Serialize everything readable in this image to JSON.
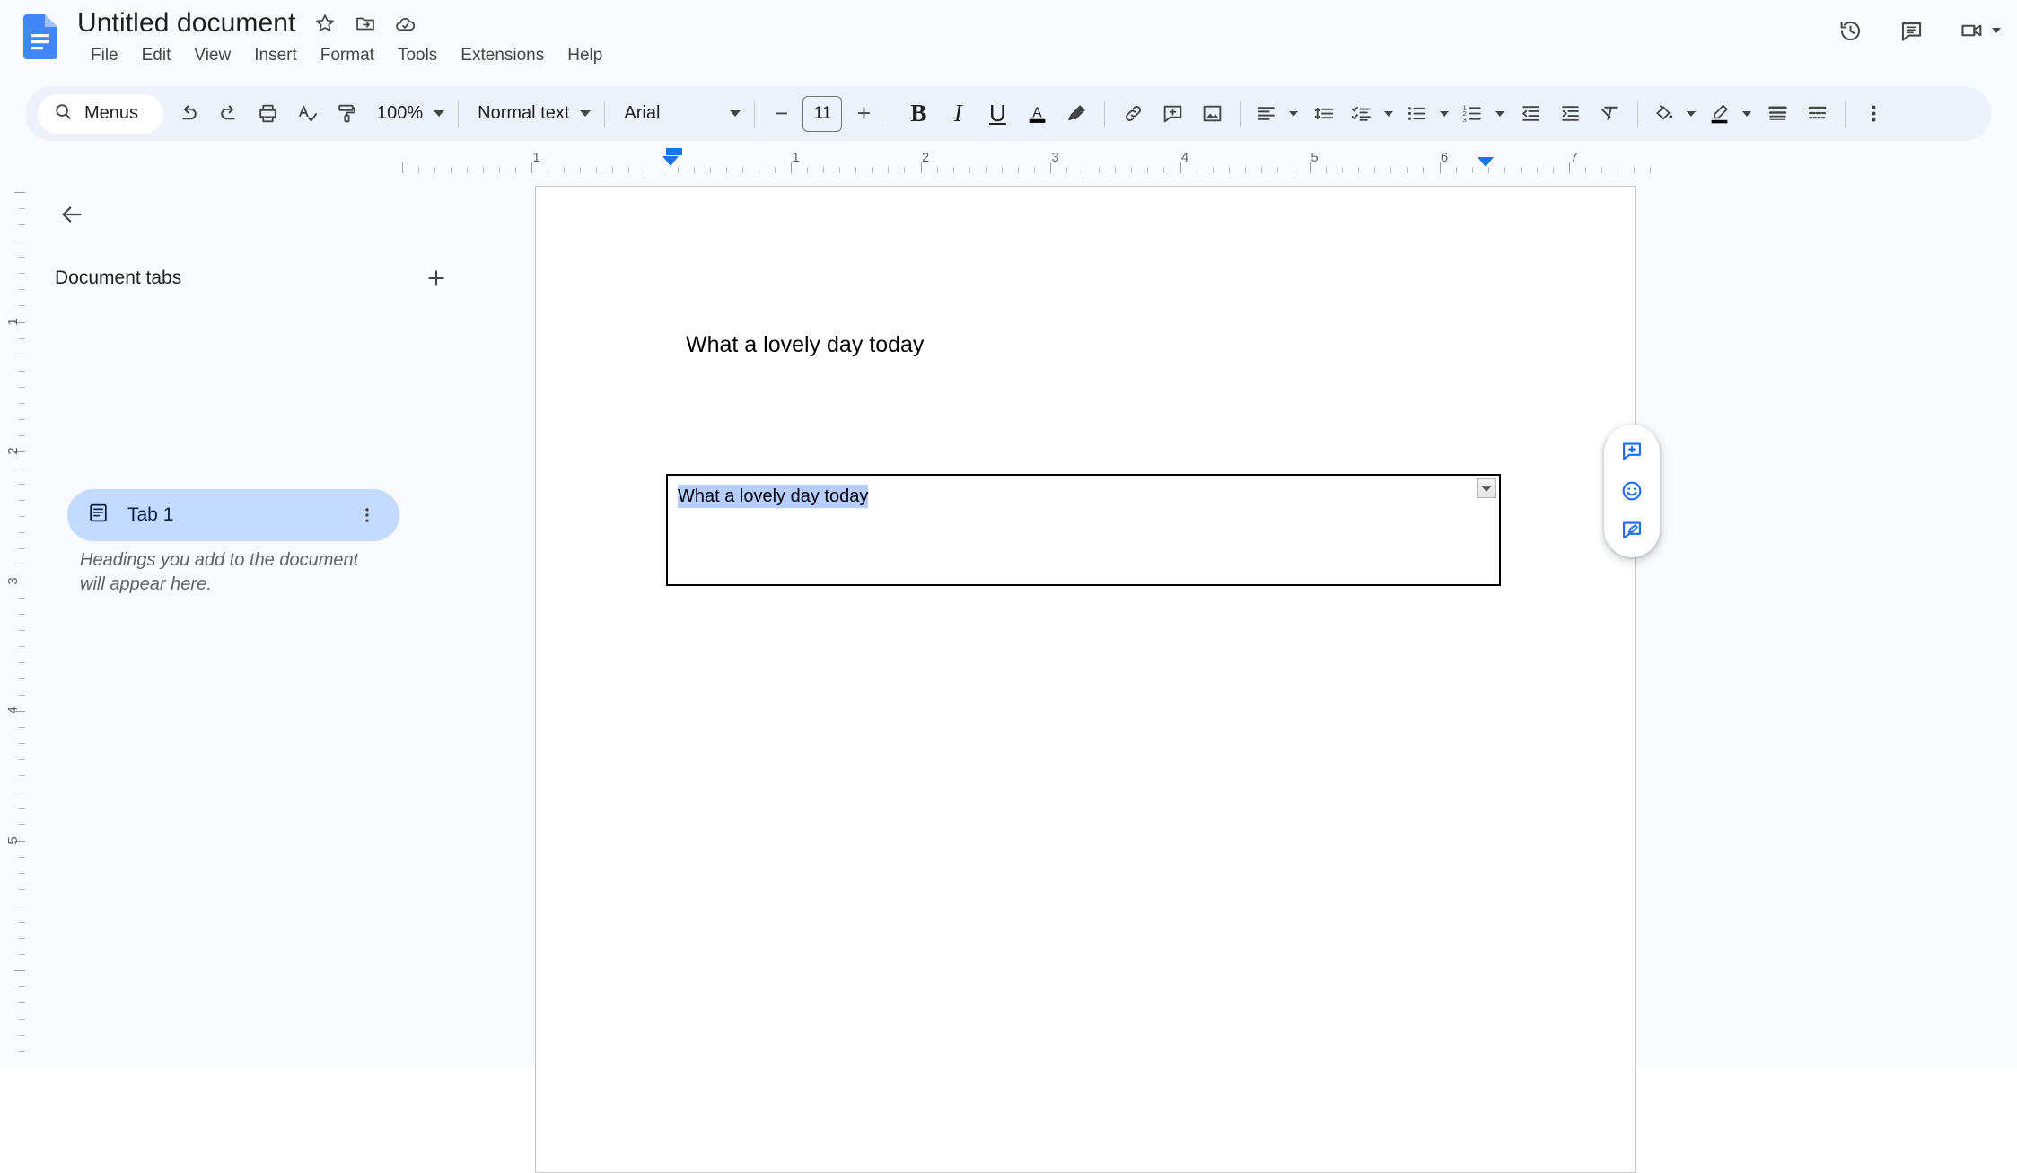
{
  "header": {
    "doc_title": "Untitled document",
    "logo_icon": "google-docs-icon",
    "title_icons": [
      {
        "name": "star-icon",
        "label": "Star"
      },
      {
        "name": "move-to-folder-icon",
        "label": "Move"
      },
      {
        "name": "cloud-saved-icon",
        "label": "Saved to Drive"
      }
    ],
    "menus": [
      "File",
      "Edit",
      "View",
      "Insert",
      "Format",
      "Tools",
      "Extensions",
      "Help"
    ],
    "right_actions": [
      {
        "name": "version-history-icon",
        "label": "Version history"
      },
      {
        "name": "comment-history-icon",
        "label": "Open comment history"
      },
      {
        "name": "video-camera-icon",
        "label": "Join or start a meeting"
      }
    ]
  },
  "toolbar": {
    "menus_search_label": "Menus",
    "zoom_value": "100%",
    "style_value": "Normal text",
    "font_value": "Arial",
    "font_size_value": "11",
    "decrease_font_label": "−",
    "increase_font_label": "+",
    "bold_label": "B",
    "italic_label": "I",
    "underline_label": "U",
    "text_color_label": "A",
    "items": [
      "search-menus",
      "undo",
      "redo",
      "print",
      "spellcheck",
      "paint-format",
      "zoom",
      "styles",
      "font",
      "font-size",
      "bold",
      "italic",
      "underline",
      "text-color",
      "highlight-color",
      "insert-link",
      "add-comment",
      "insert-image",
      "align",
      "line-spacing",
      "checklist",
      "bulleted-list",
      "numbered-list",
      "decrease-indent",
      "increase-indent",
      "clear-formatting",
      "fill-color",
      "border-color",
      "border-weight",
      "border-dash",
      "more-options"
    ]
  },
  "ruler": {
    "horizontal_numbers": [
      "1",
      "1",
      "2",
      "3",
      "4",
      "5",
      "6",
      "7"
    ],
    "vertical_numbers": [
      "1",
      "2",
      "3",
      "4",
      "5"
    ],
    "left_indent_position": "0",
    "right_indent_position": "6.5"
  },
  "sidebar": {
    "back_label": "Back",
    "section_title": "Document tabs",
    "add_tab_label": "+",
    "tabs": [
      {
        "name": "tab-1",
        "label": "Tab 1",
        "icon": "document-tab-icon",
        "selected": true
      }
    ],
    "hint_text": "Headings you add to the document will appear here."
  },
  "document": {
    "heading_text": "What a lovely day today",
    "textbox": {
      "text": "What a lovely day today",
      "selected": true,
      "selection_color": "#b6ceff",
      "scroll_button_icon": "scroll-down-arrow-icon"
    }
  },
  "floating_actions": [
    {
      "name": "add-comment-icon",
      "label": "Add comment"
    },
    {
      "name": "emoji-reaction-icon",
      "label": "Add emoji reaction"
    },
    {
      "name": "suggest-edit-icon",
      "label": "Show editing mode"
    }
  ],
  "colors": {
    "accent": "#1a73e8",
    "toolbar_bg": "#edf2fa",
    "header_bg": "#f8fafd",
    "tab_selected_bg": "#c2dbff",
    "page_bg": "#ffffff"
  }
}
